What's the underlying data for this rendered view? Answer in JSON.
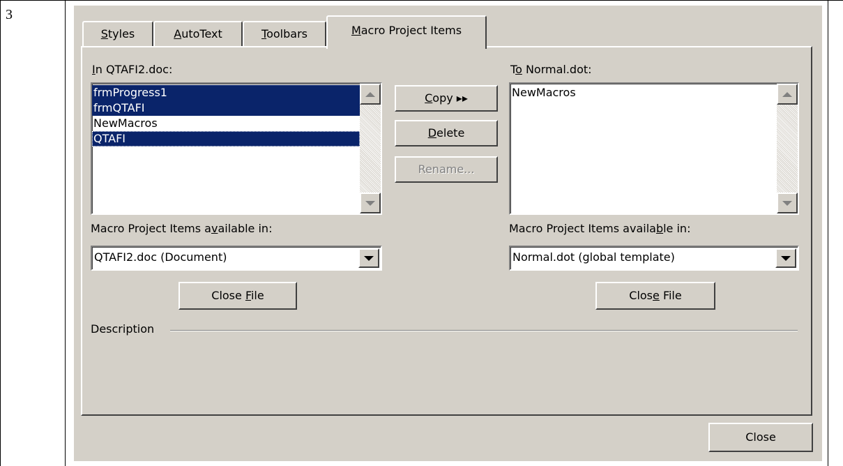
{
  "step": {
    "number": "3"
  },
  "tabs": [
    {
      "pre": "",
      "key": "S",
      "post": "tyles",
      "active": false
    },
    {
      "pre": "",
      "key": "A",
      "post": "utoText",
      "active": false
    },
    {
      "pre": "",
      "key": "T",
      "post": "oolbars",
      "active": false
    },
    {
      "pre": "",
      "key": "M",
      "post": "acro Project Items",
      "active": true
    }
  ],
  "left": {
    "label": {
      "pre": "",
      "key": "I",
      "post": "n QTAFI2.doc:"
    },
    "items": [
      {
        "text": "frmProgress1",
        "selected": true
      },
      {
        "text": "frmQTAFI",
        "selected": true
      },
      {
        "text": "NewMacros",
        "selected": false
      },
      {
        "text": "QTAFI",
        "selected": true
      }
    ],
    "available_label": {
      "pre": "Macro Project Items a",
      "key": "v",
      "post": "ailable in:"
    },
    "available_value": "QTAFI2.doc (Document)",
    "close_file": {
      "pre": "Close ",
      "key": "F",
      "post": "ile"
    }
  },
  "right": {
    "label": {
      "pre": "T",
      "key": "o",
      "post": " Normal.dot:"
    },
    "items": [
      {
        "text": "NewMacros",
        "selected": false
      }
    ],
    "available_label": {
      "pre": "Macro Project Items availa",
      "key": "b",
      "post": "le in:"
    },
    "available_value": "Normal.dot (global template)",
    "close_file": {
      "pre": "Clos",
      "key": "e",
      "post": " File"
    }
  },
  "actions": {
    "copy": {
      "pre": "",
      "key": "C",
      "post": "opy ▸▸"
    },
    "delete": {
      "pre": "",
      "key": "D",
      "post": "elete"
    },
    "rename": {
      "label": "Rename..."
    }
  },
  "description": {
    "label": "Description"
  },
  "footer": {
    "close": "Close"
  },
  "colors": {
    "dialog_bg": "#d4d0c8",
    "selection": "#0a246a",
    "disabled_text": "#808080"
  }
}
